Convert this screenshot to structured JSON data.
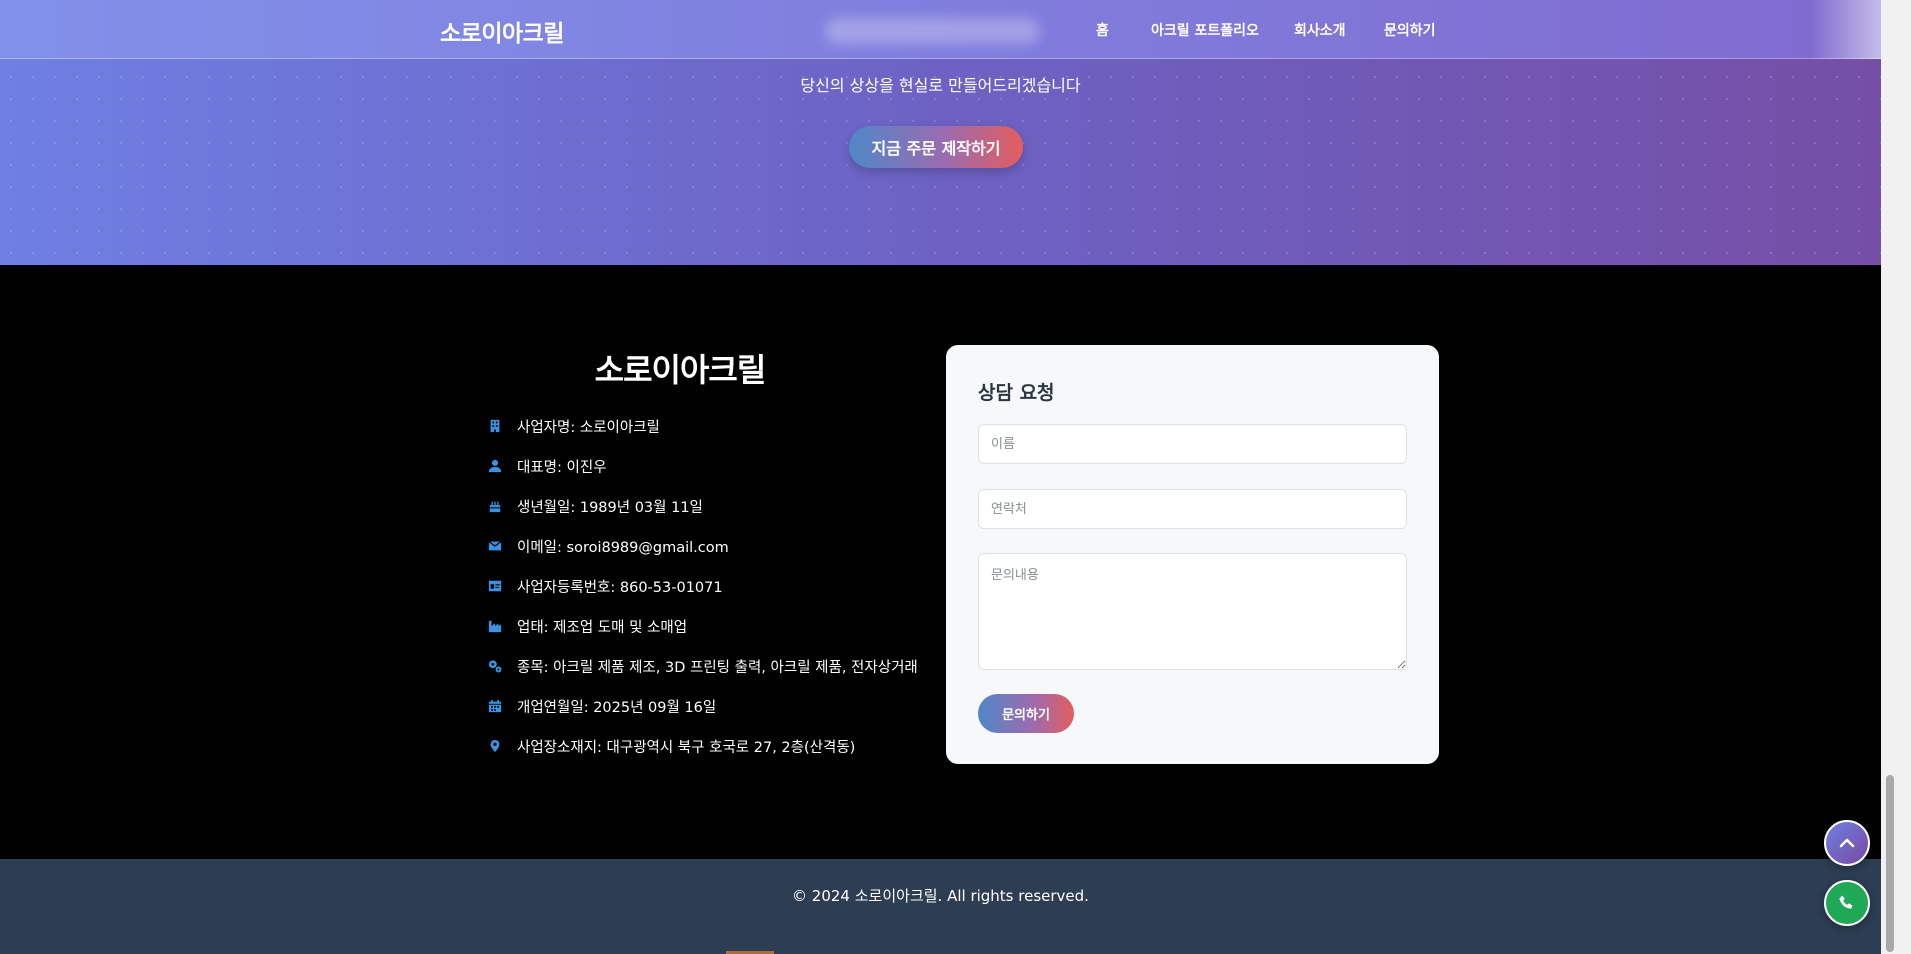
{
  "navbar": {
    "brand": "소로이아크릴",
    "links": [
      "홈",
      "아크릴 포트폴리오",
      "회사소개",
      "문의하기"
    ]
  },
  "hero": {
    "tagline": "당신의 상상을 현실로 만들어드리겠습니다",
    "cta_label": "지금 주문 제작하기"
  },
  "company": {
    "name": "소로이아크릴",
    "info": [
      {
        "icon": "building-icon",
        "text": "사업자명: 소로이아크릴"
      },
      {
        "icon": "user-icon",
        "text": "대표명: 이진우"
      },
      {
        "icon": "cake-icon",
        "text": "생년월일: 1989년 03월 11일"
      },
      {
        "icon": "envelope-icon",
        "text": "이메일: soroi8989@gmail.com"
      },
      {
        "icon": "id-card-icon",
        "text": "사업자등록번호: 860-53-01071"
      },
      {
        "icon": "industry-icon",
        "text": "업태: 제조업 도매 및 소매업"
      },
      {
        "icon": "gears-icon",
        "text": "종목: 아크릴 제품 제조, 3D 프린팅 출력, 아크릴 제품, 전자상거래"
      },
      {
        "icon": "calendar-icon",
        "text": "개업연월일: 2025년 09월 16일"
      },
      {
        "icon": "map-pin-icon",
        "text": "사업장소재지: 대구광역시 북구 호국로 27, 2층(산격동)"
      }
    ]
  },
  "form": {
    "title": "상담 요청",
    "name_placeholder": "이름",
    "phone_placeholder": "연락처",
    "message_placeholder": "문의내용",
    "submit_label": "문의하기"
  },
  "footer": {
    "copyright": "© 2024 소로이아크릴. All rights reserved."
  },
  "colors": {
    "accent_blue": "#3b92e3",
    "hero_start": "#6f7fe3",
    "hero_end": "#764ba2",
    "footer_bar": "#2d3d52",
    "call_green": "#1fa856"
  }
}
